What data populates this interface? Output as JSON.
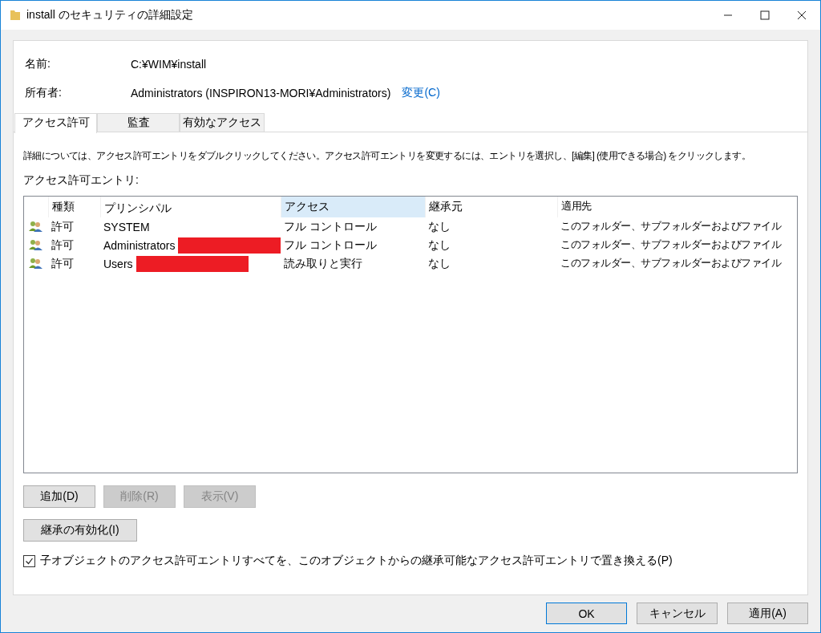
{
  "window": {
    "title": "install のセキュリティの詳細設定"
  },
  "fields": [
    {
      "label": "名前:",
      "value": "C:¥WIM¥install"
    },
    {
      "label": "所有者:",
      "value": "Administrators (INSPIRON13-MORI¥Administrators)",
      "link": "変更(C)"
    }
  ],
  "tabs": [
    {
      "label": "アクセス許可",
      "selected": true
    },
    {
      "label": "監査",
      "selected": false
    },
    {
      "label": "有効なアクセス",
      "selected": false
    }
  ],
  "description": "詳細については、アクセス許可エントリをダブルクリックしてください。アクセス許可エントリを変更するには、エントリを選択し、[編集] (使用できる場合) をクリックします。",
  "list_label": "アクセス許可エントリ:",
  "table": {
    "columns": [
      {
        "label": "種類",
        "sorted": false
      },
      {
        "label": "プリンシパル",
        "sorted": false
      },
      {
        "label": "アクセス",
        "sorted": true
      },
      {
        "label": "継承元",
        "sorted": false
      },
      {
        "label": "適用先",
        "sorted": false
      }
    ],
    "rows": [
      {
        "type": "許可",
        "principal": "SYSTEM",
        "redacted": false,
        "access": "フル コントロール",
        "inherited_from": "なし",
        "applies_to": "このフォルダー、サブフォルダーおよびファイル"
      },
      {
        "type": "許可",
        "principal": "Administrators",
        "redacted": true,
        "access": "フル コントロール",
        "inherited_from": "なし",
        "applies_to": "このフォルダー、サブフォルダーおよびファイル"
      },
      {
        "type": "許可",
        "principal": "Users",
        "redacted": true,
        "access": "読み取りと実行",
        "inherited_from": "なし",
        "applies_to": "このフォルダー、サブフォルダーおよびファイル"
      }
    ]
  },
  "action_buttons": [
    {
      "label": "追加(D)",
      "disabled": false
    },
    {
      "label": "削除(R)",
      "disabled": true
    },
    {
      "label": "表示(V)",
      "disabled": true
    }
  ],
  "inherit_button": {
    "label": "継承の有効化(I)"
  },
  "replace_checkbox": {
    "label": "子オブジェクトのアクセス許可エントリすべてを、このオブジェクトからの継承可能なアクセス許可エントリで置き換える(P)",
    "checked": true
  },
  "dialog_buttons": [
    {
      "label": "OK",
      "default": true
    },
    {
      "label": "キャンセル",
      "default": false
    },
    {
      "label": "適用(A)",
      "default": false
    }
  ]
}
